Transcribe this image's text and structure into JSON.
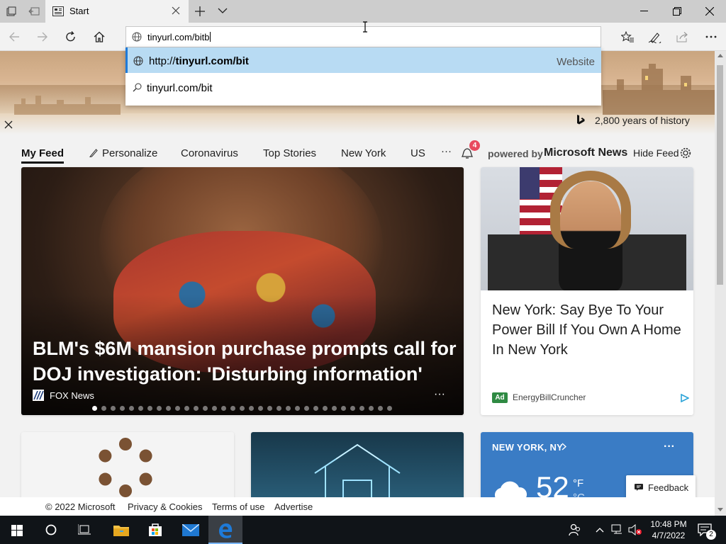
{
  "browser": {
    "tab_title": "Start",
    "address_value": "tinyurl.com/bitb",
    "suggestions": [
      {
        "prefix": "http://",
        "bold": "tinyurl.com/bit",
        "type": "Website"
      },
      {
        "text": "tinyurl.com/bit"
      }
    ]
  },
  "hero": {
    "caption": "2,800 years of history"
  },
  "feed_nav": {
    "items": [
      "My Feed",
      "Personalize",
      "Coronavirus",
      "Top Stories",
      "New York",
      "US"
    ],
    "more": "···",
    "notification_count": "4",
    "powered_by_prefix": "powered by",
    "powered_by_brand": "Microsoft News",
    "hide_feed": "Hide Feed"
  },
  "main_story": {
    "title": "BLM's $6M mansion purchase prompts call for DOJ investigation: 'Disturbing information'",
    "source": "FOX News",
    "more": "···",
    "carousel": {
      "count": 33,
      "active": 0
    }
  },
  "ad_story": {
    "title": "New York: Say Bye To Your Power Bill If You Own A Home In New York",
    "badge": "Ad",
    "advertiser": "EnergyBillCruncher"
  },
  "weather": {
    "location": "NEW YORK, NY",
    "more": "···",
    "temp": "52",
    "unit_f": "°F",
    "unit_c": "°C"
  },
  "feedback": "Feedback",
  "footer": {
    "copyright": "© 2022 Microsoft",
    "privacy": "Privacy & Cookies",
    "terms": "Terms of use",
    "advertise": "Advertise"
  },
  "taskbar": {
    "time": "10:48 PM",
    "date": "4/7/2022",
    "notifications": "2"
  },
  "colors": {
    "suggest_highlight": "#b8dbf3",
    "taskbar": "#101418",
    "edge_blue": "#1e7ad8",
    "weather_blue": "#3a7cc5",
    "notif_red": "#e84a5f",
    "ad_green": "#2f8a43"
  }
}
